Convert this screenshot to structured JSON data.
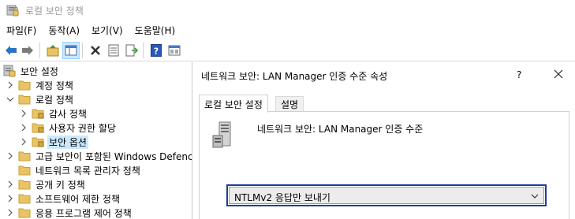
{
  "window": {
    "title": "로컬 보안 정책"
  },
  "menu": [
    {
      "label": "파일(F)"
    },
    {
      "label": "동작(A)"
    },
    {
      "label": "보기(V)"
    },
    {
      "label": "도움말(H)"
    }
  ],
  "toolbar": {
    "buttons": [
      "back-icon",
      "forward-icon",
      "up-folder-icon",
      "show-hide-tree-icon",
      "delete-icon",
      "properties-icon",
      "export-list-icon",
      "help-icon",
      "view-icon"
    ]
  },
  "tree": {
    "root": {
      "label": "보안 설정"
    },
    "items": [
      {
        "label": "계정 정책"
      },
      {
        "label": "로컬 정책"
      },
      {
        "label": "감사 정책"
      },
      {
        "label": "사용자 권한 할당"
      },
      {
        "label": "보안 옵션"
      },
      {
        "label": "고급 보안이 포함된 Windows Defenc"
      },
      {
        "label": "네트워크 목록 관리자 정책"
      },
      {
        "label": "공개 키 정책"
      },
      {
        "label": "소프트웨어 제한 정책"
      },
      {
        "label": "응용 프로그램 제어 정책"
      }
    ]
  },
  "dialog": {
    "title": "네트워크 보안: LAN Manager 인증 수준 속성",
    "help_label": "?",
    "close_label": "✕",
    "tabs": [
      {
        "label": "로컬 보안 설정"
      },
      {
        "label": "설명"
      }
    ],
    "policy_name": "네트워크 보안: LAN Manager 인증 수준",
    "selected_value": "NTLMv2 응답만 보내기"
  },
  "colors": {
    "selection": "#cce8ff",
    "folder": "#e8c465",
    "select_border": "#1a3e9c"
  }
}
